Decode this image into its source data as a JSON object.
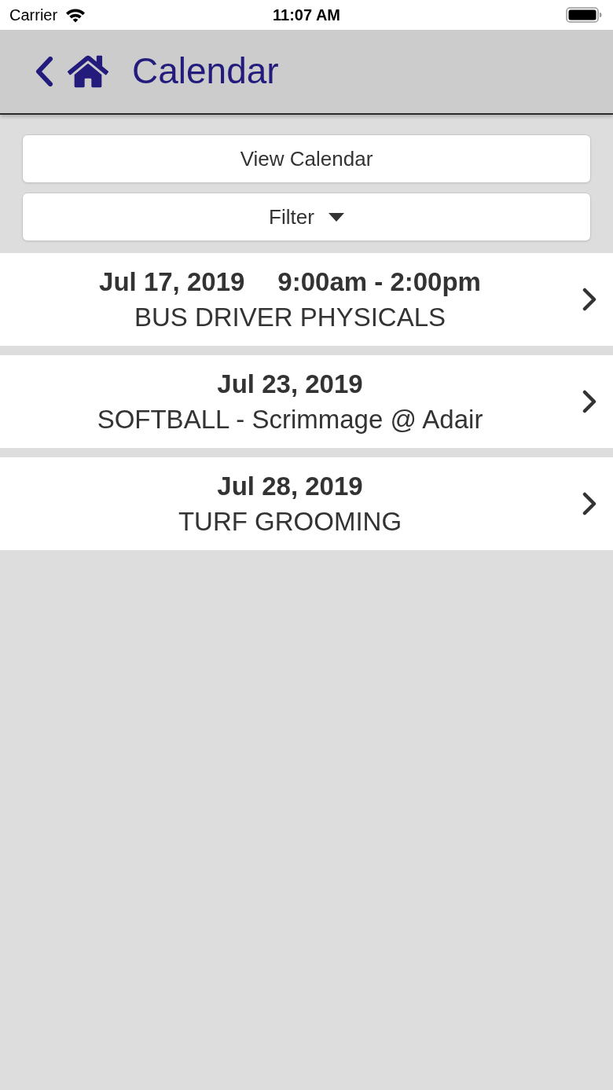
{
  "status_bar": {
    "carrier": "Carrier",
    "time": "11:07 AM"
  },
  "header": {
    "title": "Calendar"
  },
  "buttons": [
    {
      "kind": "plain",
      "label": "View Calendar"
    },
    {
      "kind": "dropdown",
      "label": "Filter"
    }
  ],
  "events": [
    {
      "date": "Jul 17, 2019",
      "time": "9:00am - 2:00pm",
      "title": "BUS DRIVER PHYSICALS"
    },
    {
      "date": "Jul 23, 2019",
      "title": "SOFTBALL - Scrimmage @ Adair"
    },
    {
      "date": "Jul 28, 2019",
      "title": "TURF GROOMING"
    }
  ]
}
